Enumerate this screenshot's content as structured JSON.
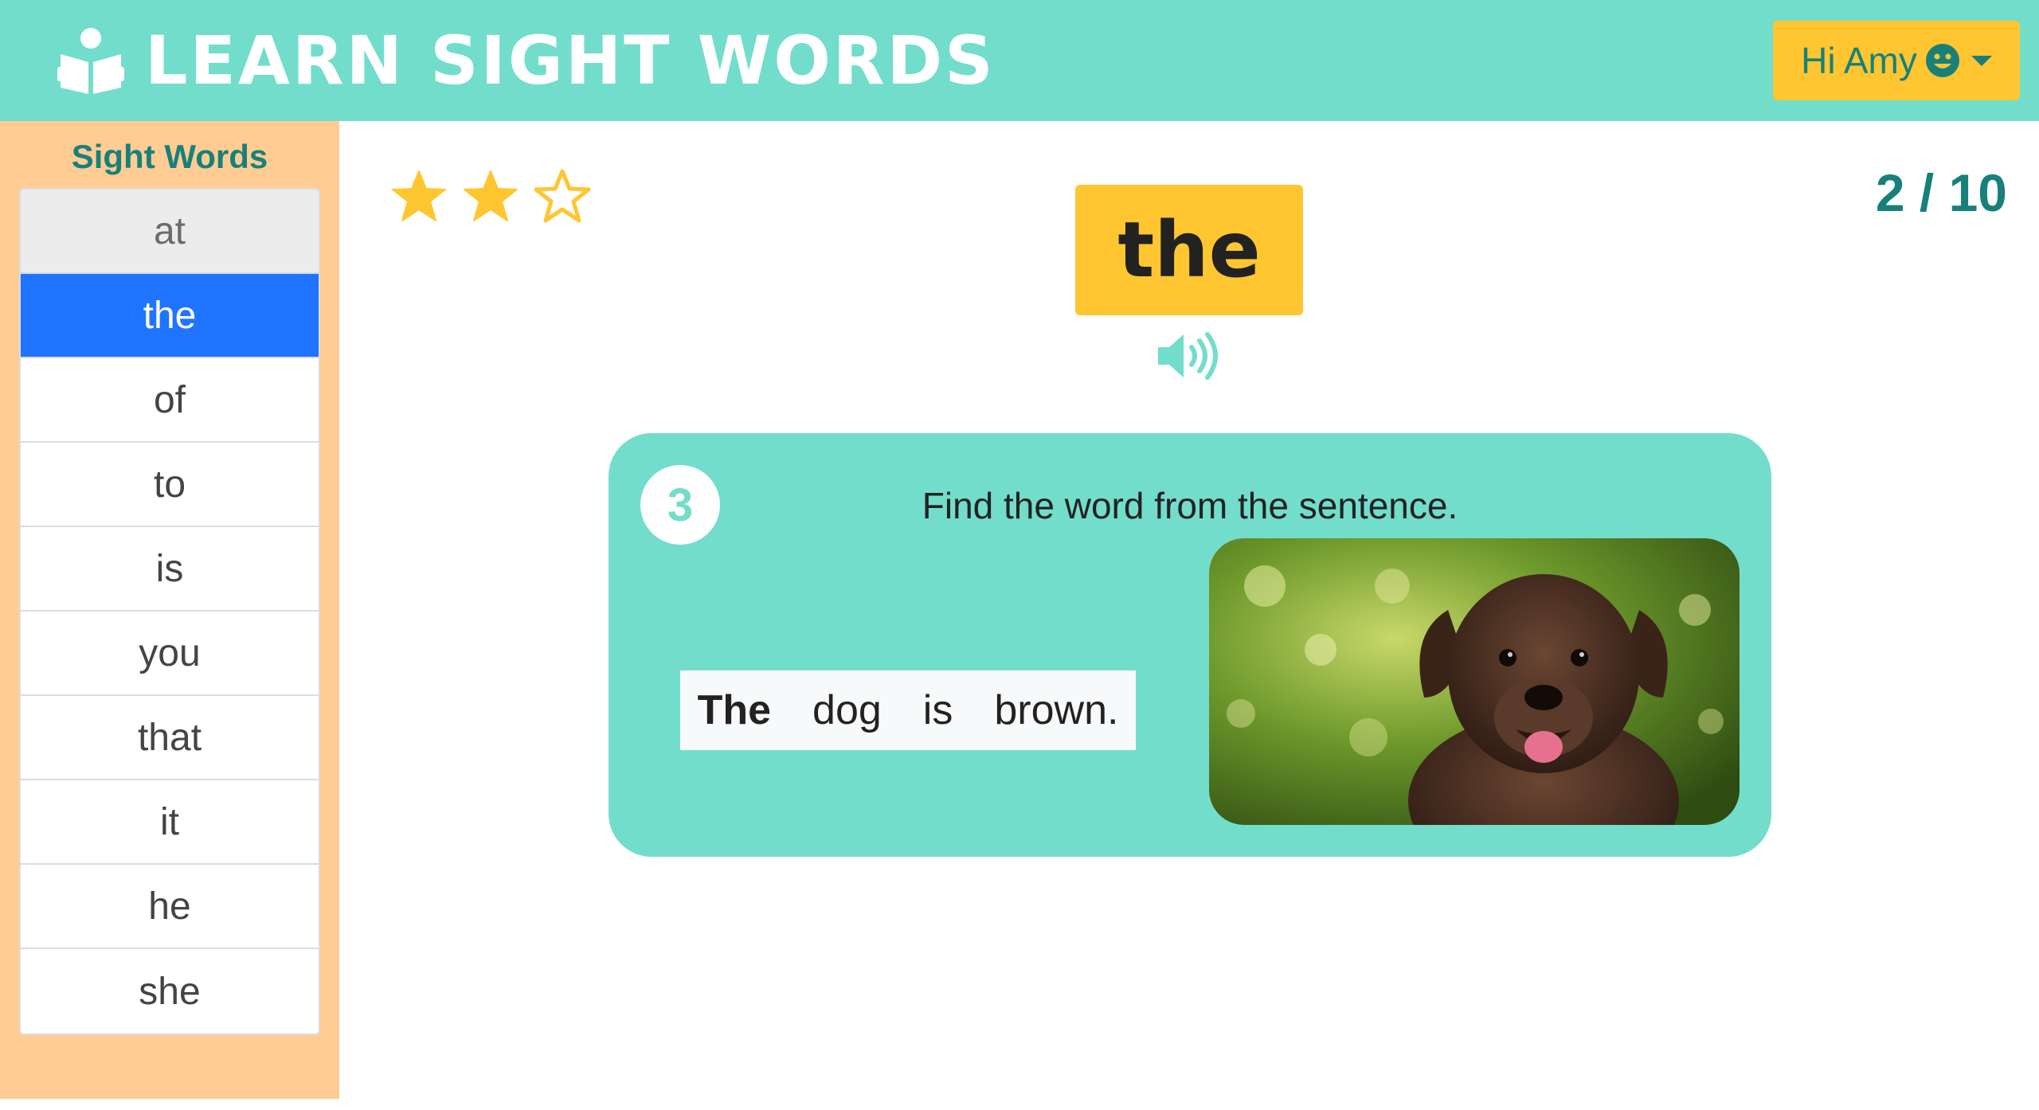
{
  "header": {
    "title": "LEARN SIGHT WORDS",
    "logo_icon": "reading-person-icon",
    "user_menu": {
      "label": "Hi Amy",
      "icon": "smile-icon",
      "dropdown_icon": "caret-down-icon"
    }
  },
  "sidebar": {
    "title": "Sight Words",
    "words": [
      {
        "label": "at",
        "state": "visited"
      },
      {
        "label": "the",
        "state": "active"
      },
      {
        "label": "of",
        "state": "default"
      },
      {
        "label": "to",
        "state": "default"
      },
      {
        "label": "is",
        "state": "default"
      },
      {
        "label": "you",
        "state": "default"
      },
      {
        "label": "that",
        "state": "default"
      },
      {
        "label": "it",
        "state": "default"
      },
      {
        "label": "he",
        "state": "default"
      },
      {
        "label": "she",
        "state": "default"
      }
    ]
  },
  "rating": {
    "filled": 2,
    "total": 3
  },
  "progress": "2 / 10",
  "target_word": "the",
  "activity": {
    "step": "3",
    "instruction": "Find the word from the sentence.",
    "sentence_words": [
      {
        "text": "The",
        "selected": true
      },
      {
        "text": "dog",
        "selected": false
      },
      {
        "text": "is",
        "selected": false
      },
      {
        "text": "brown.",
        "selected": false
      }
    ],
    "image_icon": "puppy-photo"
  },
  "colors": {
    "teal": "#73ddcc",
    "dark_teal": "#18807a",
    "yellow": "#ffc631",
    "sidebar_orange": "#ffcc94",
    "active_blue": "#1f75ff"
  }
}
